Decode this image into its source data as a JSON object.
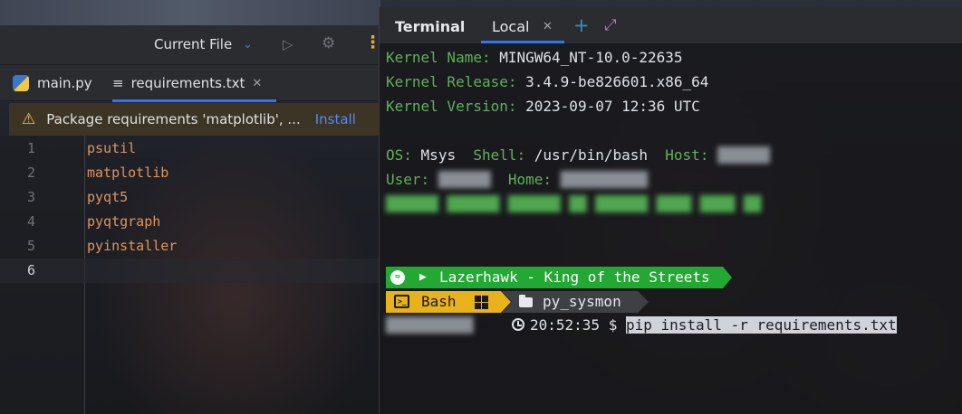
{
  "run_toolbar": {
    "config_label": "Current File"
  },
  "editor_tabs": [
    {
      "label": "main.py"
    },
    {
      "label": "requirements.txt",
      "close": "✕"
    }
  ],
  "warning": {
    "text": "Package requirements 'matplotlib', ...",
    "action": "Install"
  },
  "editor": {
    "lines": [
      {
        "num": "1",
        "text": "psutil"
      },
      {
        "num": "2",
        "text": "matplotlib"
      },
      {
        "num": "3",
        "text": "pyqt5"
      },
      {
        "num": "4",
        "text": "pyqtgraph"
      },
      {
        "num": "5",
        "text": "pyinstaller"
      },
      {
        "num": "6",
        "text": ""
      }
    ]
  },
  "terminal": {
    "title": "Terminal",
    "tab_label": "Local",
    "tab_close": "✕",
    "sysinfo": {
      "kernel_name_label": "Kernel Name:",
      "kernel_name": "MINGW64_NT-10.0-22635",
      "kernel_release_label": "Kernel Release:",
      "kernel_release": "3.4.9-be826601.x86_64",
      "kernel_version_label": "Kernel Version:",
      "kernel_version": "2023-09-07 12:36 UTC",
      "os_label": "OS:",
      "os": "Msys",
      "shell_label": "Shell:",
      "shell": "/usr/bin/bash",
      "host_label": "Host:",
      "host": "██████",
      "user_label": "User:",
      "user": "██████",
      "home_label": "Home:",
      "home": "██████████",
      "extra_line": "██████ ██████ ██████ ██ ██████ ████ ████ ██"
    },
    "prompt": {
      "now_playing": "Lazerhawk - King of the Streets",
      "shell": "Bash",
      "directory": "py_sysmon",
      "user_host": "██████████",
      "time": "20:52:35",
      "symbol": "$",
      "command": "pip install -r requirements.txt"
    }
  },
  "colors": {
    "accent": "#3574f0",
    "terminal_green": "#5eb158",
    "segment_green": "#22a833",
    "segment_yellow": "#e8b21a",
    "requirement_text": "#e1935b"
  }
}
